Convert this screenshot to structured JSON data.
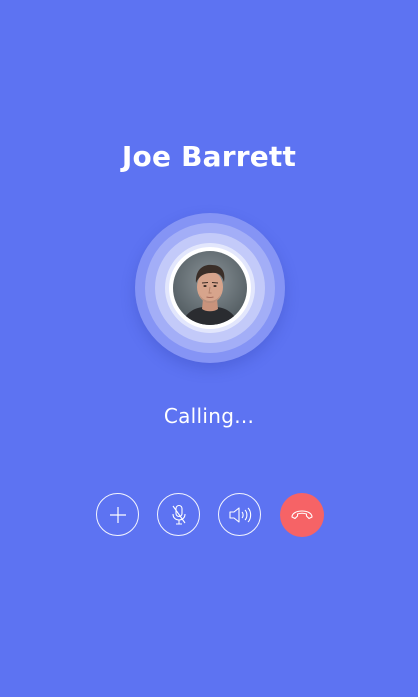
{
  "call": {
    "caller_name": "Joe Barrett",
    "status": "Calling..."
  },
  "avatar": {
    "icon": "caller-photo"
  },
  "controls": {
    "add": {
      "icon": "plus-icon"
    },
    "mute": {
      "icon": "microphone-off-icon"
    },
    "speaker": {
      "icon": "speaker-icon"
    },
    "end": {
      "icon": "phone-hangup-icon",
      "color": "#f66366"
    }
  },
  "colors": {
    "background": "#5d73f2",
    "text": "#ffffff",
    "end_call": "#f66366"
  }
}
